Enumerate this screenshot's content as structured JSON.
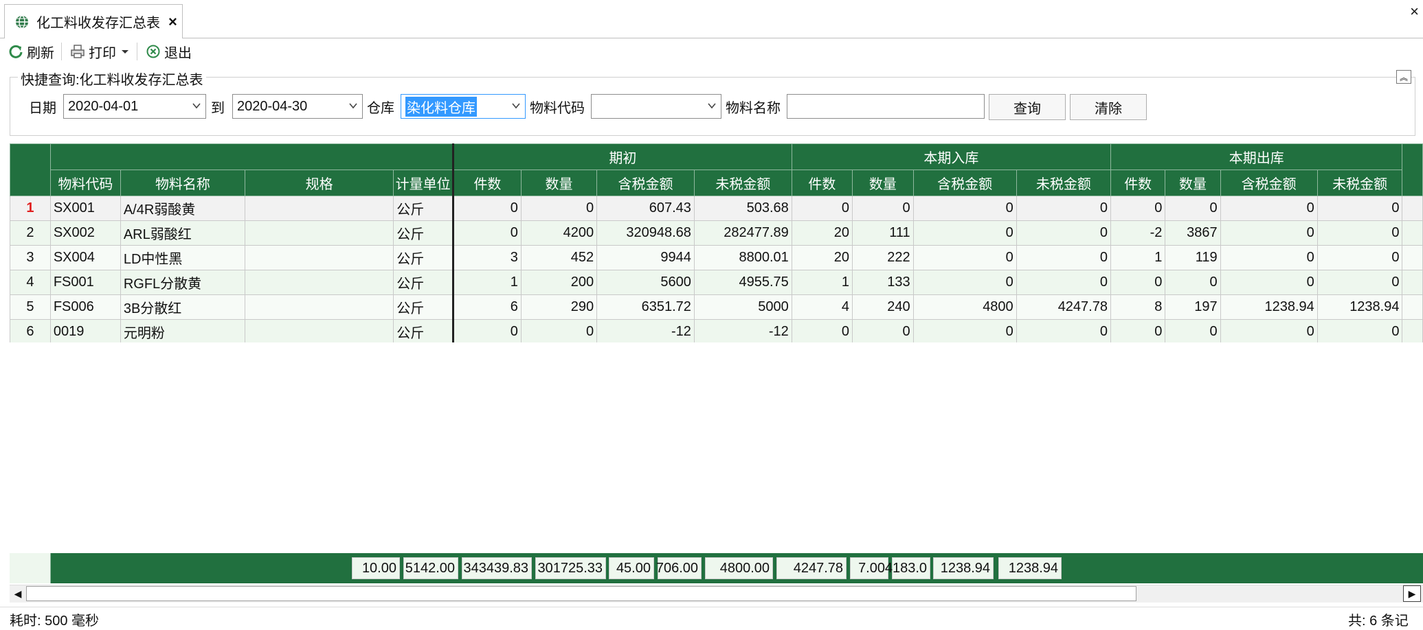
{
  "tab": {
    "title": "化工料收发存汇总表",
    "close": "×"
  },
  "window": {
    "close": "×"
  },
  "toolbar": {
    "refresh": "刷新",
    "print": "打印",
    "exit": "退出"
  },
  "query": {
    "title": "快捷查询:化工料收发存汇总表",
    "date_label": "日期",
    "date_from": "2020-04-01",
    "to_label": "到",
    "date_to": "2020-04-30",
    "warehouse_label": "仓库",
    "warehouse_value": "染化料仓库",
    "code_label": "物料代码",
    "code_value": "",
    "name_label": "物料名称",
    "name_value": "",
    "search_button": "查询",
    "clear_button": "清除"
  },
  "grid": {
    "groups": [
      "期初",
      "本期入库",
      "本期出库"
    ],
    "columns": [
      "物料代码",
      "物料名称",
      "规格",
      "计量单位",
      "件数",
      "数量",
      "含税金额",
      "未税金额",
      "件数",
      "数量",
      "含税金额",
      "未税金额",
      "件数",
      "数量",
      "含税金额",
      "未税金额"
    ],
    "rows": [
      {
        "no": "1",
        "cells": [
          "SX001",
          "A/4R弱酸黄",
          "",
          "公斤",
          "0",
          "0",
          "607.43",
          "503.68",
          "0",
          "0",
          "0",
          "0",
          "0",
          "0",
          "0",
          "0"
        ]
      },
      {
        "no": "2",
        "cells": [
          "SX002",
          "ARL弱酸红",
          "",
          "公斤",
          "0",
          "4200",
          "320948.68",
          "282477.89",
          "20",
          "111",
          "0",
          "0",
          "-2",
          "3867",
          "0",
          "0"
        ]
      },
      {
        "no": "3",
        "cells": [
          "SX004",
          "LD中性黑",
          "",
          "公斤",
          "3",
          "452",
          "9944",
          "8800.01",
          "20",
          "222",
          "0",
          "0",
          "1",
          "119",
          "0",
          "0"
        ]
      },
      {
        "no": "4",
        "cells": [
          "FS001",
          "RGFL分散黄",
          "",
          "公斤",
          "1",
          "200",
          "5600",
          "4955.75",
          "1",
          "133",
          "0",
          "0",
          "0",
          "0",
          "0",
          "0"
        ]
      },
      {
        "no": "5",
        "cells": [
          "FS006",
          "3B分散红",
          "",
          "公斤",
          "6",
          "290",
          "6351.72",
          "5000",
          "4",
          "240",
          "4800",
          "4247.78",
          "8",
          "197",
          "1238.94",
          "1238.94"
        ]
      },
      {
        "no": "6",
        "cells": [
          "0019",
          "元明粉",
          "",
          "公斤",
          "0",
          "0",
          "-12",
          "-12",
          "0",
          "0",
          "0",
          "0",
          "0",
          "0",
          "0",
          "0"
        ]
      }
    ]
  },
  "footer": {
    "sums": [
      "10.00",
      "5142.00",
      "343439.83",
      "301725.33",
      "45.00",
      "706.00",
      "4800.00",
      "4247.78",
      "7.00",
      "4183.0",
      "1238.94",
      "1238.94"
    ]
  },
  "status": {
    "elapsed": "耗时: 500 毫秒",
    "total": "共: 6 条记"
  },
  "colors": {
    "header_green": "#21703f",
    "row_tint": "#eef7ee",
    "selection": "#3399ff"
  }
}
